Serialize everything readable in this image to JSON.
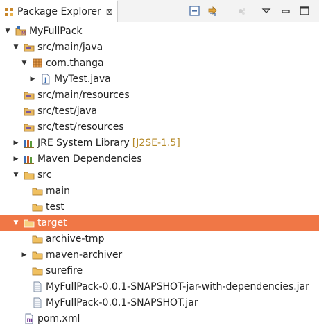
{
  "view": {
    "title": "Package Explorer",
    "close_glyph": "⊠",
    "toolbar": [
      "collapse-all-icon",
      "link-with-editor-icon",
      "focus-icon",
      "view-menu-icon",
      "minimize-icon",
      "maximize-icon"
    ]
  },
  "tree": {
    "nodes": [
      {
        "label": "MyFullPack",
        "icon": "maven-project-icon",
        "expanded": true
      },
      {
        "label": "src/main/java",
        "icon": "source-folder-icon",
        "expanded": true
      },
      {
        "label": "com.thanga",
        "icon": "package-icon",
        "expanded": true
      },
      {
        "label": "MyTest.java",
        "icon": "java-file-icon",
        "expanded": false
      },
      {
        "label": "src/main/resources",
        "icon": "source-folder-icon"
      },
      {
        "label": "src/test/java",
        "icon": "source-folder-icon"
      },
      {
        "label": "src/test/resources",
        "icon": "source-folder-icon"
      },
      {
        "label": "JRE System Library",
        "decoration": "[J2SE-1.5]",
        "icon": "library-icon",
        "expanded": false
      },
      {
        "label": "Maven Dependencies",
        "icon": "library-icon",
        "expanded": false
      },
      {
        "label": "src",
        "icon": "folder-icon",
        "expanded": true
      },
      {
        "label": "main",
        "icon": "folder-icon"
      },
      {
        "label": "test",
        "icon": "folder-icon"
      },
      {
        "label": "target",
        "icon": "folder-icon",
        "expanded": true,
        "selected": true
      },
      {
        "label": "archive-tmp",
        "icon": "folder-icon"
      },
      {
        "label": "maven-archiver",
        "icon": "folder-icon",
        "expanded": false
      },
      {
        "label": "surefire",
        "icon": "folder-icon"
      },
      {
        "label": "MyFullPack-0.0.1-SNAPSHOT-jar-with-dependencies.jar",
        "icon": "file-icon"
      },
      {
        "label": "MyFullPack-0.0.1-SNAPSHOT.jar",
        "icon": "file-icon"
      },
      {
        "label": "pom.xml",
        "icon": "pom-file-icon"
      }
    ]
  },
  "colors": {
    "selection": "#f07746",
    "decoration": "#b58a2a"
  }
}
